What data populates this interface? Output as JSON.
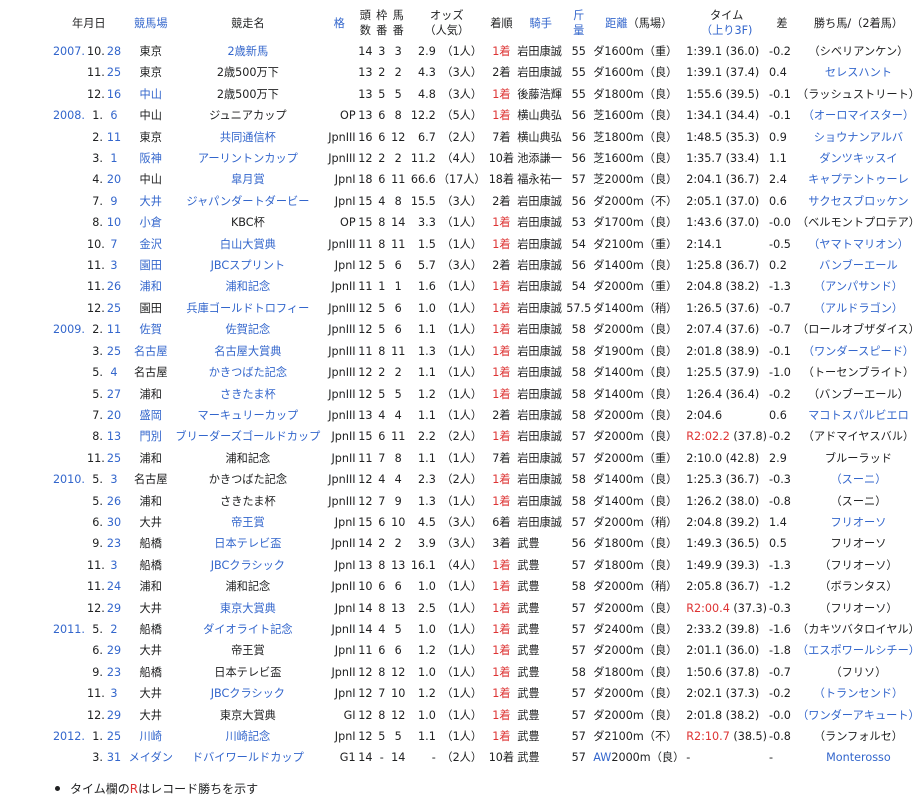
{
  "headers": {
    "date": "年月日",
    "course": "競馬場",
    "race": "競走名",
    "grade": "格",
    "runners_l1": "頭",
    "runners_l2": "数",
    "frame_l1": "枠",
    "frame_l2": "番",
    "horse_l1": "馬",
    "horse_l2": "番",
    "odds_l1": "オッズ",
    "odds_l2": "（人気）",
    "finish": "着順",
    "jockey": "騎手",
    "weight_l1": "斤",
    "weight_l2": "量",
    "distance": "距離",
    "track": "（馬場）",
    "time_l1": "タイム",
    "time_l2": "（上り3F)",
    "margin": "差",
    "winner": "勝ち馬/（2着馬）"
  },
  "rows": [
    {
      "y": "2007.",
      "m": "10.",
      "d": "28",
      "course": "東京",
      "race": "2歳新馬",
      "grade": "",
      "n": "14",
      "f": "3",
      "h": "3",
      "odds": "2.9",
      "pop": "（1人）",
      "fin": "1着",
      "jockey": "岩田康誠",
      "wt": "55",
      "dist": "ダ1600m（重）",
      "time": "1:39.1 (36.0)",
      "diff": "-0.2",
      "win": "（シベリアンケン）",
      "lc": 0,
      "lr": 1,
      "lw": 0
    },
    {
      "y": "",
      "m": "11.",
      "d": "25",
      "course": "東京",
      "race": "2歳500万下",
      "grade": "",
      "n": "13",
      "f": "2",
      "h": "2",
      "odds": "4.3",
      "pop": "（3人）",
      "fin": "2着",
      "jockey": "岩田康誠",
      "wt": "55",
      "dist": "ダ1600m（良）",
      "time": "1:39.1 (37.4)",
      "diff": "0.4",
      "win": "セレスハント",
      "lc": 0,
      "lr": 0,
      "lw": 1
    },
    {
      "y": "",
      "m": "12.",
      "d": "16",
      "course": "中山",
      "race": "2歳500万下",
      "grade": "",
      "n": "13",
      "f": "5",
      "h": "5",
      "odds": "4.8",
      "pop": "（3人）",
      "fin": "1着",
      "jockey": "後藤浩輝",
      "wt": "55",
      "dist": "ダ1800m（良）",
      "time": "1:55.6 (39.5)",
      "diff": "-0.1",
      "win": "（ラッシュストリート）",
      "lc": 1,
      "lr": 0,
      "lw": 0
    },
    {
      "y": "2008.",
      "m": "1.",
      "d": "6",
      "course": "中山",
      "race": "ジュニアカップ",
      "grade": "OP",
      "n": "13",
      "f": "6",
      "h": "8",
      "odds": "12.2",
      "pop": "（5人）",
      "fin": "1着",
      "jockey": "横山典弘",
      "wt": "56",
      "dist": "芝1600m（良）",
      "time": "1:34.1 (34.4)",
      "diff": "-0.1",
      "win": "（オーロマイスター）",
      "lc": 0,
      "lr": 0,
      "lw": 1
    },
    {
      "y": "",
      "m": "2.",
      "d": "11",
      "course": "東京",
      "race": "共同通信杯",
      "grade": "JpnIII",
      "n": "16",
      "f": "6",
      "h": "12",
      "odds": "6.7",
      "pop": "（2人）",
      "fin": "7着",
      "jockey": "横山典弘",
      "wt": "56",
      "dist": "芝1800m（良）",
      "time": "1:48.5 (35.3)",
      "diff": "0.9",
      "win": "ショウナンアルバ",
      "lc": 0,
      "lr": 1,
      "lw": 1
    },
    {
      "y": "",
      "m": "3.",
      "d": "1",
      "course": "阪神",
      "race": "アーリントンカップ",
      "grade": "JpnIII",
      "n": "12",
      "f": "2",
      "h": "2",
      "odds": "11.2",
      "pop": "（4人）",
      "fin": "10着",
      "jockey": "池添謙一",
      "wt": "56",
      "dist": "芝1600m（良）",
      "time": "1:35.7 (33.4)",
      "diff": "1.1",
      "win": "ダンツキッスイ",
      "lc": 1,
      "lr": 1,
      "lw": 1
    },
    {
      "y": "",
      "m": "4.",
      "d": "20",
      "course": "中山",
      "race": "皐月賞",
      "grade": "JpnI",
      "n": "18",
      "f": "6",
      "h": "11",
      "odds": "66.6",
      "pop": "（17人）",
      "fin": "18着",
      "jockey": "福永祐一",
      "wt": "57",
      "dist": "芝2000m（良）",
      "time": "2:04.1 (36.7)",
      "diff": "2.4",
      "win": "キャプテントゥーレ",
      "lc": 0,
      "lr": 1,
      "lw": 1
    },
    {
      "y": "",
      "m": "7.",
      "d": "9",
      "course": "大井",
      "race": "ジャパンダートダービー",
      "grade": "JpnI",
      "n": "15",
      "f": "4",
      "h": "8",
      "odds": "15.5",
      "pop": "（3人）",
      "fin": "2着",
      "jockey": "岩田康誠",
      "wt": "56",
      "dist": "ダ2000m（不）",
      "time": "2:05.1 (37.0)",
      "diff": "0.6",
      "win": "サクセスブロッケン",
      "lc": 1,
      "lr": 1,
      "lw": 1
    },
    {
      "y": "",
      "m": "8.",
      "d": "10",
      "course": "小倉",
      "race": "KBC杯",
      "grade": "OP",
      "n": "15",
      "f": "8",
      "h": "14",
      "odds": "3.3",
      "pop": "（1人）",
      "fin": "1着",
      "jockey": "岩田康誠",
      "wt": "53",
      "dist": "ダ1700m（良）",
      "time": "1:43.6 (37.0)",
      "diff": "-0.0",
      "win": "（ベルモントプロテア）",
      "lc": 1,
      "lr": 0,
      "lw": 0
    },
    {
      "y": "",
      "m": "10.",
      "d": "7",
      "course": "金沢",
      "race": "白山大賞典",
      "grade": "JpnIII",
      "n": "11",
      "f": "8",
      "h": "11",
      "odds": "1.5",
      "pop": "（1人）",
      "fin": "1着",
      "jockey": "岩田康誠",
      "wt": "54",
      "dist": "ダ2100m（重）",
      "time": "2:14.1",
      "diff": "-0.5",
      "win": "（ヤマトマリオン）",
      "lc": 1,
      "lr": 1,
      "lw": 1
    },
    {
      "y": "",
      "m": "11.",
      "d": "3",
      "course": "園田",
      "race": "JBCスプリント",
      "grade": "JpnI",
      "n": "12",
      "f": "5",
      "h": "6",
      "odds": "5.7",
      "pop": "（3人）",
      "fin": "2着",
      "jockey": "岩田康誠",
      "wt": "56",
      "dist": "ダ1400m（良）",
      "time": "1:25.8 (36.7)",
      "diff": "0.2",
      "win": "バンブーエール",
      "lc": 1,
      "lr": 1,
      "lw": 1
    },
    {
      "y": "",
      "m": "11.",
      "d": "26",
      "course": "浦和",
      "race": "浦和記念",
      "grade": "JpnII",
      "n": "11",
      "f": "1",
      "h": "1",
      "odds": "1.6",
      "pop": "（1人）",
      "fin": "1着",
      "jockey": "岩田康誠",
      "wt": "54",
      "dist": "ダ2000m（重）",
      "time": "2:04.8 (38.2)",
      "diff": "-1.3",
      "win": "（アンパサンド）",
      "lc": 1,
      "lr": 1,
      "lw": 1
    },
    {
      "y": "",
      "m": "12.",
      "d": "25",
      "course": "園田",
      "race": "兵庫ゴールドトロフィー",
      "grade": "JpnIII",
      "n": "12",
      "f": "5",
      "h": "6",
      "odds": "1.0",
      "pop": "（1人）",
      "fin": "1着",
      "jockey": "岩田康誠",
      "wt": "57.5",
      "dist": "ダ1400m（稍）",
      "time": "1:26.5 (37.6)",
      "diff": "-0.7",
      "win": "（アルドラゴン）",
      "lc": 0,
      "lr": 1,
      "lw": 1
    },
    {
      "y": "2009.",
      "m": "2.",
      "d": "11",
      "course": "佐賀",
      "race": "佐賀記念",
      "grade": "JpnIII",
      "n": "12",
      "f": "5",
      "h": "6",
      "odds": "1.1",
      "pop": "（1人）",
      "fin": "1着",
      "jockey": "岩田康誠",
      "wt": "58",
      "dist": "ダ2000m（良）",
      "time": "2:07.4 (37.6)",
      "diff": "-0.7",
      "win": "（ロールオブザダイス）",
      "lc": 1,
      "lr": 1,
      "lw": 0
    },
    {
      "y": "",
      "m": "3.",
      "d": "25",
      "course": "名古屋",
      "race": "名古屋大賞典",
      "grade": "JpnIII",
      "n": "11",
      "f": "8",
      "h": "11",
      "odds": "1.3",
      "pop": "（1人）",
      "fin": "1着",
      "jockey": "岩田康誠",
      "wt": "58",
      "dist": "ダ1900m（良）",
      "time": "2:01.8 (38.9)",
      "diff": "-0.1",
      "win": "（ワンダースピード）",
      "lc": 1,
      "lr": 1,
      "lw": 1
    },
    {
      "y": "",
      "m": "5.",
      "d": "4",
      "course": "名古屋",
      "race": "かきつばた記念",
      "grade": "JpnIII",
      "n": "12",
      "f": "2",
      "h": "2",
      "odds": "1.1",
      "pop": "（1人）",
      "fin": "1着",
      "jockey": "岩田康誠",
      "wt": "58",
      "dist": "ダ1400m（良）",
      "time": "1:25.5 (37.9)",
      "diff": "-1.0",
      "win": "（トーセンブライト）",
      "lc": 0,
      "lr": 1,
      "lw": 0
    },
    {
      "y": "",
      "m": "5.",
      "d": "27",
      "course": "浦和",
      "race": "さきたま杯",
      "grade": "JpnIII",
      "n": "12",
      "f": "5",
      "h": "5",
      "odds": "1.2",
      "pop": "（1人）",
      "fin": "1着",
      "jockey": "岩田康誠",
      "wt": "58",
      "dist": "ダ1400m（良）",
      "time": "1:26.4 (36.4)",
      "diff": "-0.2",
      "win": "（バンブーエール）",
      "lc": 0,
      "lr": 1,
      "lw": 0
    },
    {
      "y": "",
      "m": "7.",
      "d": "20",
      "course": "盛岡",
      "race": "マーキュリーカップ",
      "grade": "JpnIII",
      "n": "13",
      "f": "4",
      "h": "4",
      "odds": "1.1",
      "pop": "（1人）",
      "fin": "2着",
      "jockey": "岩田康誠",
      "wt": "58",
      "dist": "ダ2000m（良）",
      "time": "2:04.6",
      "diff": "0.6",
      "win": "マコトスパルビエロ",
      "lc": 1,
      "lr": 1,
      "lw": 1
    },
    {
      "y": "",
      "m": "8.",
      "d": "13",
      "course": "門別",
      "race": "ブリーダーズゴールドカップ",
      "grade": "JpnII",
      "n": "15",
      "f": "6",
      "h": "11",
      "odds": "2.2",
      "pop": "（2人）",
      "fin": "1着",
      "jockey": "岩田康誠",
      "wt": "57",
      "dist": "ダ2000m（良）",
      "timeR": "R",
      "timeRec": "2:02.2",
      "time": " (37.8)",
      "diff": "-0.2",
      "win": "（アドマイヤスバル）",
      "lc": 1,
      "lr": 1,
      "lw": 0
    },
    {
      "y": "",
      "m": "11.",
      "d": "25",
      "course": "浦和",
      "race": "浦和記念",
      "grade": "JpnII",
      "n": "11",
      "f": "7",
      "h": "8",
      "odds": "1.1",
      "pop": "（1人）",
      "fin": "7着",
      "jockey": "岩田康誠",
      "wt": "57",
      "dist": "ダ2000m（重）",
      "time": "2:10.0 (42.8)",
      "diff": "2.9",
      "win": "ブルーラッド",
      "lc": 0,
      "lr": 0,
      "lw": 0
    },
    {
      "y": "2010.",
      "m": "5.",
      "d": "3",
      "course": "名古屋",
      "race": "かきつばた記念",
      "grade": "JpnIII",
      "n": "12",
      "f": "4",
      "h": "4",
      "odds": "2.3",
      "pop": "（2人）",
      "fin": "1着",
      "jockey": "岩田康誠",
      "wt": "58",
      "dist": "ダ1400m（良）",
      "time": "1:25.3 (36.7)",
      "diff": "-0.3",
      "win": "（スーニ）",
      "lc": 0,
      "lr": 0,
      "lw": 1
    },
    {
      "y": "",
      "m": "5.",
      "d": "26",
      "course": "浦和",
      "race": "さきたま杯",
      "grade": "JpnIII",
      "n": "12",
      "f": "7",
      "h": "9",
      "odds": "1.3",
      "pop": "（1人）",
      "fin": "1着",
      "jockey": "岩田康誠",
      "wt": "58",
      "dist": "ダ1400m（良）",
      "time": "1:26.2 (38.0)",
      "diff": "-0.8",
      "win": "（スーニ）",
      "lc": 0,
      "lr": 0,
      "lw": 0
    },
    {
      "y": "",
      "m": "6.",
      "d": "30",
      "course": "大井",
      "race": "帝王賞",
      "grade": "JpnI",
      "n": "15",
      "f": "6",
      "h": "10",
      "odds": "4.5",
      "pop": "（3人）",
      "fin": "6着",
      "jockey": "岩田康誠",
      "wt": "57",
      "dist": "ダ2000m（稍）",
      "time": "2:04.8 (39.2)",
      "diff": "1.4",
      "win": "フリオーソ",
      "lc": 0,
      "lr": 1,
      "lw": 1
    },
    {
      "y": "",
      "m": "9.",
      "d": "23",
      "course": "船橋",
      "race": "日本テレビ盃",
      "grade": "JpnII",
      "n": "14",
      "f": "2",
      "h": "2",
      "odds": "3.9",
      "pop": "（3人）",
      "fin": "3着",
      "jockey": "武豊",
      "wt": "56",
      "dist": "ダ1800m（良）",
      "time": "1:49.3 (36.5)",
      "diff": "0.5",
      "win": "フリオーソ",
      "lc": 0,
      "lr": 1,
      "lw": 0
    },
    {
      "y": "",
      "m": "11.",
      "d": "3",
      "course": "船橋",
      "race": "JBCクラシック",
      "grade": "JpnI",
      "n": "13",
      "f": "8",
      "h": "13",
      "odds": "16.1",
      "pop": "（4人）",
      "fin": "1着",
      "jockey": "武豊",
      "wt": "57",
      "dist": "ダ1800m（良）",
      "time": "1:49.9 (39.3)",
      "diff": "-1.3",
      "win": "（フリオーソ）",
      "lc": 0,
      "lr": 1,
      "lw": 0
    },
    {
      "y": "",
      "m": "11.",
      "d": "24",
      "course": "浦和",
      "race": "浦和記念",
      "grade": "JpnII",
      "n": "10",
      "f": "6",
      "h": "6",
      "odds": "1.0",
      "pop": "（1人）",
      "fin": "1着",
      "jockey": "武豊",
      "wt": "58",
      "dist": "ダ2000m（稍）",
      "time": "2:05.8 (36.7)",
      "diff": "-1.2",
      "win": "（ボランタス）",
      "lc": 0,
      "lr": 0,
      "lw": 0
    },
    {
      "y": "",
      "m": "12.",
      "d": "29",
      "course": "大井",
      "race": "東京大賞典",
      "grade": "JpnI",
      "n": "14",
      "f": "8",
      "h": "13",
      "odds": "2.5",
      "pop": "（1人）",
      "fin": "1着",
      "jockey": "武豊",
      "wt": "57",
      "dist": "ダ2000m（良）",
      "timeR": "R",
      "timeRec": "2:00.4",
      "time": " (37.3)",
      "diff": "-0.3",
      "win": "（フリオーソ）",
      "lc": 0,
      "lr": 1,
      "lw": 0
    },
    {
      "y": "2011.",
      "m": "5.",
      "d": "2",
      "course": "船橋",
      "race": "ダイオライト記念",
      "grade": "JpnII",
      "n": "14",
      "f": "4",
      "h": "5",
      "odds": "1.0",
      "pop": "（1人）",
      "fin": "1着",
      "jockey": "武豊",
      "wt": "57",
      "dist": "ダ2400m（良）",
      "time": "2:33.2 (39.8)",
      "diff": "-1.6",
      "win": "（カキツバタロイヤル）",
      "lc": 0,
      "lr": 1,
      "lw": 0
    },
    {
      "y": "",
      "m": "6.",
      "d": "29",
      "course": "大井",
      "race": "帝王賞",
      "grade": "JpnI",
      "n": "11",
      "f": "6",
      "h": "6",
      "odds": "1.2",
      "pop": "（1人）",
      "fin": "1着",
      "jockey": "武豊",
      "wt": "57",
      "dist": "ダ2000m（良）",
      "time": "2:01.1 (36.0)",
      "diff": "-1.8",
      "win": "（エスポワールシチー）",
      "lc": 0,
      "lr": 0,
      "lw": 1
    },
    {
      "y": "",
      "m": "9.",
      "d": "23",
      "course": "船橋",
      "race": "日本テレビ盃",
      "grade": "JpnII",
      "n": "12",
      "f": "8",
      "h": "12",
      "odds": "1.0",
      "pop": "（1人）",
      "fin": "1着",
      "jockey": "武豊",
      "wt": "58",
      "dist": "ダ1800m（良）",
      "time": "1:50.6 (37.8)",
      "diff": "-0.7",
      "win": "（フリソ）",
      "lc": 0,
      "lr": 0,
      "lw": 0
    },
    {
      "y": "",
      "m": "11.",
      "d": "3",
      "course": "大井",
      "race": "JBCクラシック",
      "grade": "JpnI",
      "n": "12",
      "f": "7",
      "h": "10",
      "odds": "1.2",
      "pop": "（1人）",
      "fin": "1着",
      "jockey": "武豊",
      "wt": "57",
      "dist": "ダ2000m（良）",
      "time": "2:02.1 (37.3)",
      "diff": "-0.2",
      "win": "（トランセンド）",
      "lc": 0,
      "lr": 1,
      "lw": 1
    },
    {
      "y": "",
      "m": "12.",
      "d": "29",
      "course": "大井",
      "race": "東京大賞典",
      "grade": "GI",
      "n": "12",
      "f": "8",
      "h": "12",
      "odds": "1.0",
      "pop": "（1人）",
      "fin": "1着",
      "jockey": "武豊",
      "wt": "57",
      "dist": "ダ2000m（良）",
      "time": "2:01.8 (38.2)",
      "diff": "-0.0",
      "win": "（ワンダーアキュート）",
      "lc": 0,
      "lr": 0,
      "lw": 1
    },
    {
      "y": "2012.",
      "m": "1.",
      "d": "25",
      "course": "川崎",
      "race": "川崎記念",
      "grade": "JpnI",
      "n": "12",
      "f": "5",
      "h": "5",
      "odds": "1.1",
      "pop": "（1人）",
      "fin": "1着",
      "jockey": "武豊",
      "wt": "57",
      "dist": "ダ2100m（不）",
      "timeR": "R",
      "timeRec": "2:10.7",
      "time": " (38.5)",
      "diff": "-0.8",
      "win": "（ランフォルセ）",
      "lc": 1,
      "lr": 1,
      "lw": 0
    },
    {
      "y": "",
      "m": "3.",
      "d": "31",
      "course": "メイダン",
      "race": "ドバイワールドカップ",
      "grade": "G1",
      "n": "14",
      "f": "-",
      "h": "14",
      "odds": "-",
      "pop": "（2人）",
      "fin": "10着",
      "jockey": "武豊",
      "wt": "57",
      "dist": "AW2000m（良）",
      "time": "-",
      "diff": "-",
      "win": "Monterosso",
      "lc": 1,
      "lr": 1,
      "lw": 1,
      "aw": 1
    }
  ],
  "note": {
    "pre": "タイム欄の",
    "r": "R",
    "post": "はレコード勝ちを示す"
  }
}
